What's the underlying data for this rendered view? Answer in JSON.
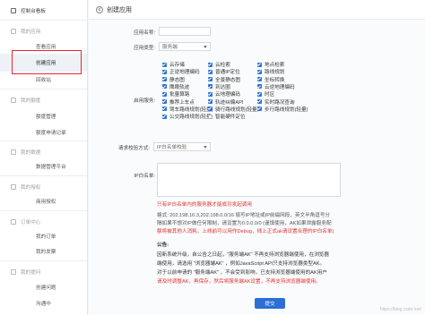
{
  "sidebar": {
    "dashboard": "控制台看板",
    "my_apps_section": "我的应用",
    "view_apps": "查看应用",
    "create_app": "创建应用",
    "recycle_bin": "回收站",
    "my_quota_section": "我的额度",
    "quota_mgmt": "额度管理",
    "quota_apply": "额度申请记录",
    "my_data_section": "我的数据",
    "data_upload": "数据管理平台",
    "my_license_section": "我的授权",
    "commercial_license": "商用授权",
    "orders_section": "订单中心",
    "my_orders": "我的订单",
    "my_invoice": "我的发票",
    "my_tickets_section": "我的提问",
    "create_ticket": "创建问题",
    "talk": "沟通中"
  },
  "header": {
    "title": "创建应用"
  },
  "form": {
    "app_name_label": "应用名称:",
    "app_type_label": "应用类型:",
    "app_type_value": "服务端",
    "services_label": "启用服务:",
    "verify_label": "请求校验方式:",
    "verify_value": "IP白名单校验",
    "ip_whitelist_label": "IP白名单:"
  },
  "services": [
    {
      "label": "云存储",
      "checked": true
    },
    {
      "label": "云检索",
      "checked": true
    },
    {
      "label": "地点检索",
      "checked": true
    },
    {
      "label": "正逆地理编码",
      "checked": true
    },
    {
      "label": "普通IP定位",
      "checked": true
    },
    {
      "label": "路线规划",
      "checked": true
    },
    {
      "label": "静态图",
      "checked": true
    },
    {
      "label": "全景静态图",
      "checked": true
    },
    {
      "label": "坐标转换",
      "checked": true
    },
    {
      "label": "鹰眼轨迹",
      "checked": true
    },
    {
      "label": "到达圈",
      "checked": true
    },
    {
      "label": "云逆地理编码",
      "checked": true
    },
    {
      "label": "批量算路",
      "checked": true
    },
    {
      "label": "云地理编码",
      "checked": true
    },
    {
      "label": "时区",
      "checked": true
    },
    {
      "label": "推荐上车点",
      "checked": true
    },
    {
      "label": "轨迹纠偏API",
      "checked": true
    },
    {
      "label": "实时路况查询",
      "checked": true
    },
    {
      "label": "驾车路线规划(轻量)",
      "checked": true
    },
    {
      "label": "骑行路线规划(轻量)",
      "checked": true
    },
    {
      "label": "步行路线规划(轻量)",
      "checked": true
    },
    {
      "label": "公交路线规划(轻量)",
      "checked": true
    },
    {
      "label": "智能硬件定位",
      "checked": false
    }
  ],
  "notes": {
    "ip_warning": "只有IP白名单内的服务器才能成功发起调用",
    "ip_format_1": "格式: 202.198.16.3,202.198.0.0/16 填写IP地址或IP前缀网段，英文半角逗号分",
    "ip_format_2": "隔如果不想对IP做任何限制，请设置为0.0.0.0/0 (谨慎使用，AK如果泄露服务配",
    "ip_format_3": "额将被其他人消耗，上线前可以用作Debug，线上正式ak请设置合理的IP白名单)",
    "notice_title": "公告:",
    "notice_1": "因新系统升级，自公告之日起，\"服务端AK\" 不再支持浏览器端使用，在浏览器",
    "notice_2": "端使用，请选用 \"浏览器端AK\" ，例如JavaScript API只支持浏览器类型AK。",
    "notice_3": "对于以前申请的 \"服务端AK\" ，不会受到影响，已支持浏览器端使用的AK用户",
    "notice_4": "请及时调整AK，再保存，然后将服务端AK设置，不再支持浏览器端使用。",
    "submit": "提交"
  },
  "watermark": "https://blog.csdn.net/"
}
